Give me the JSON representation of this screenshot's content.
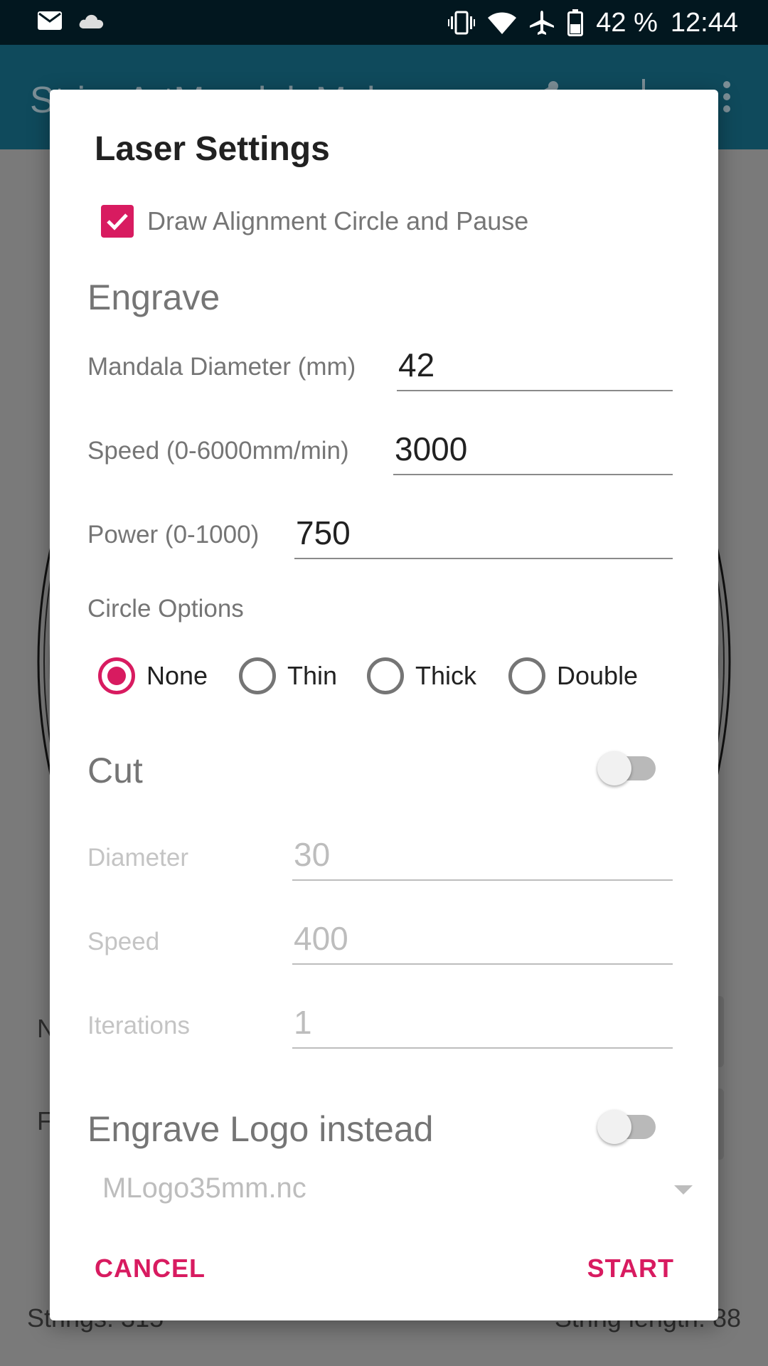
{
  "status_bar": {
    "battery_percent": "42 %",
    "time": "12:44",
    "icons": [
      "mail-icon",
      "cloud-icon",
      "vibrate-icon",
      "wifi-icon",
      "airplane-icon",
      "battery-icon"
    ]
  },
  "app_bar": {
    "title": "StringArtMandalaMaker",
    "icons": [
      "share-icon",
      "download-icon",
      "more-icon"
    ]
  },
  "background": {
    "strings_text": "Strings: 315",
    "string_length_text": "String length: 88",
    "row_1_partial": "N",
    "row_2_partial": "F"
  },
  "dialog": {
    "title": "Laser Settings",
    "alignment_checkbox": {
      "label": "Draw Alignment Circle and Pause",
      "checked": true
    },
    "engrave": {
      "heading": "Engrave",
      "mandala_diameter": {
        "label": "Mandala Diameter (mm)",
        "value": "42"
      },
      "speed": {
        "label": "Speed (0-6000mm/min)",
        "value": "3000"
      },
      "power": {
        "label": "Power (0-1000)",
        "value": "750"
      },
      "circle_options": {
        "label": "Circle Options",
        "options": [
          "None",
          "Thin",
          "Thick",
          "Double"
        ],
        "selected": "None"
      }
    },
    "cut": {
      "heading": "Cut",
      "enabled": false,
      "diameter": {
        "label": "Diameter",
        "value": "30"
      },
      "speed": {
        "label": "Speed",
        "value": "400"
      },
      "iterations": {
        "label": "Iterations",
        "value": "1"
      }
    },
    "logo": {
      "heading": "Engrave Logo instead",
      "enabled": false,
      "file": "MLogo35mm.nc"
    },
    "buttons": {
      "cancel": "CANCEL",
      "start": "START"
    }
  },
  "colors": {
    "accent": "#d81b60",
    "status_bar": "#02171f",
    "app_bar": "#0f4a5c"
  }
}
